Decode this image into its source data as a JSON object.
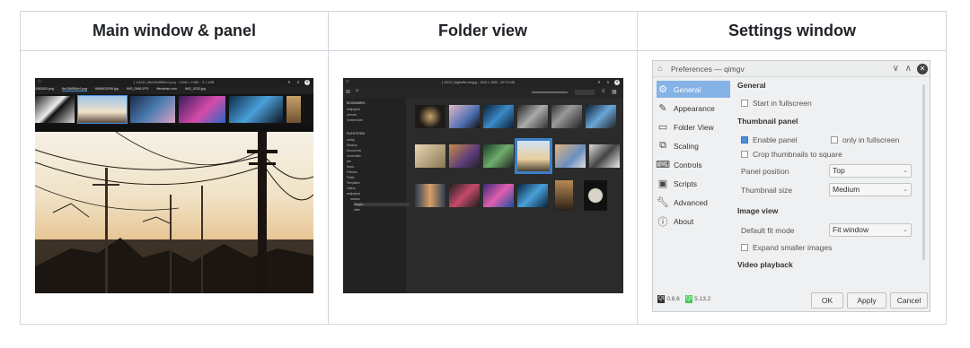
{
  "headers": [
    "Main window & panel",
    "Folder view",
    "Settings window"
  ],
  "main_window": {
    "title": "[ 13/16 ] 8e43b85f6e4.png - 1908 x 1080 - 3.1 MiB",
    "tabs": [
      "1083003.png",
      "8e43b85f6e4.png",
      "6848910299.jpg",
      "IMG_0946.JPG",
      "ffemchan.com",
      "IMG_0233.jpg"
    ]
  },
  "folder_view": {
    "title": "[ 10/10 ] bigbuffer-kw.jpg - 1920 x 1080 - 407.8 KiB",
    "sidebar_bookmarks_header": "BOOKMARKS",
    "bookmarks": [
      "wallpapers",
      "pictures",
      "Screenshots"
    ],
    "sidebar_filesystem_header": "FILESYSTEM",
    "folders": [
      "config",
      "Desktop",
      "Documents",
      "Downloads",
      "dev",
      "Music",
      "Pictures",
      "Public",
      "Templates",
      "Videos",
      "wallpapers",
      "random",
      "images",
      "other"
    ]
  },
  "settings_window": {
    "title": "Preferences — qimgv",
    "nav": [
      "General",
      "Appearance",
      "Folder View",
      "Scaling",
      "Controls",
      "Scripts",
      "Advanced",
      "About"
    ],
    "sections": {
      "general": "General",
      "thumbnail_panel": "Thumbnail panel",
      "image_view": "Image view",
      "video_playback": "Video playback"
    },
    "options": {
      "start_fullscreen": "Start in fullscreen",
      "enable_panel": "Enable panel",
      "only_fullscreen": "only in fullscreen",
      "crop_thumbnails": "Crop thumbnails to square",
      "expand_smaller": "Expand smaller images"
    },
    "labels": {
      "panel_position": "Panel position",
      "thumbnail_size": "Thumbnail size",
      "default_fit_mode": "Default fit mode"
    },
    "values": {
      "panel_position": "Top",
      "thumbnail_size": "Medium",
      "default_fit_mode": "Fit window"
    },
    "checks": {
      "start_fullscreen": false,
      "enable_panel": true,
      "only_fullscreen": false,
      "crop_thumbnails": false,
      "expand_smaller": false
    },
    "version_app_badge": "QI",
    "version_app": "0.8.6",
    "version_qt_badge": "Qt",
    "version_qt": "5.13.2",
    "buttons": {
      "ok": "OK",
      "apply": "Apply",
      "cancel": "Cancel"
    },
    "accent_color": "#85b3e6"
  }
}
